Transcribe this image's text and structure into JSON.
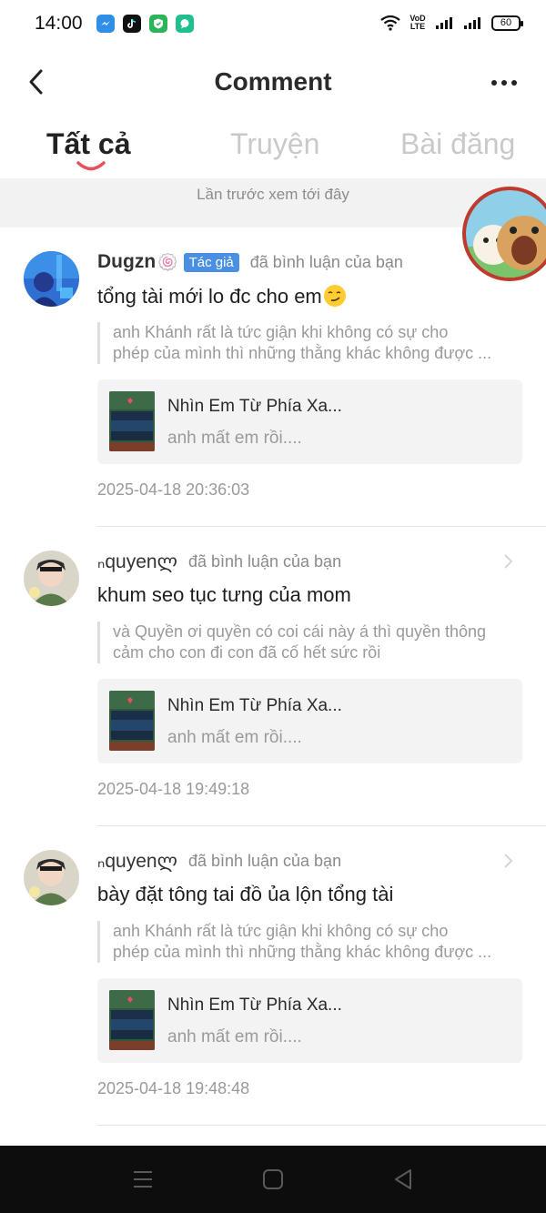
{
  "status_bar": {
    "time": "14:00",
    "volte_top": "VoD",
    "volte_bottom": "LTE",
    "battery": "60",
    "apps": [
      "messenger-icon",
      "tiktok-icon",
      "shield-app-icon",
      "chat-app-icon"
    ]
  },
  "header": {
    "title": "Comment"
  },
  "tabs": [
    {
      "label": "Tất cả",
      "active": true
    },
    {
      "label": "Truyện",
      "active": false
    },
    {
      "label": "Bài đăng",
      "active": false
    }
  ],
  "banner": {
    "text": "Lần trước xem tới đây"
  },
  "comments": [
    {
      "username": "Dugzn",
      "user_emoji": "🍥",
      "badge": "Tác giả",
      "action": "đã bình luận của bạn",
      "text": "tổng tài mới lo đc cho em",
      "quote_line1": "anh Khánh rất là tức giận khi không có sự cho",
      "quote_line2": "phép của mình thì những thằng khác không được ...",
      "story_title": "Nhìn Em Từ Phía Xa...",
      "story_sub": "anh mất em rồi....",
      "timestamp": "2025-04-18 20:36:03"
    },
    {
      "username": "ₙquyenლ",
      "action": "đã bình luận của bạn",
      "text": "khum seo tục tưng của mom",
      "quote_line1": "và Quyền ơi quyền có coi cái này á thì quyền thông",
      "quote_line2": "cảm cho con đi con đã cố hết sức rồi",
      "story_title": "Nhìn Em Từ Phía Xa...",
      "story_sub": "anh mất em rồi....",
      "timestamp": "2025-04-18 19:49:18"
    },
    {
      "username": "ₙquyenლ",
      "action": "đã bình luận của bạn",
      "text": "bày đặt tông tai đồ ủa lộn tổng tài",
      "quote_line1": "anh Khánh rất là tức giận khi không có sự cho",
      "quote_line2": "phép của mình thì những thằng khác không được ...",
      "story_title": "Nhìn Em Từ Phía Xa...",
      "story_sub": "anh mất em rồi....",
      "timestamp": "2025-04-18 19:48:48"
    }
  ],
  "colors": {
    "author_badge": "#4a90e2",
    "tab_indicator": "#e8505b",
    "nav_bar": "#0d0d0d"
  }
}
